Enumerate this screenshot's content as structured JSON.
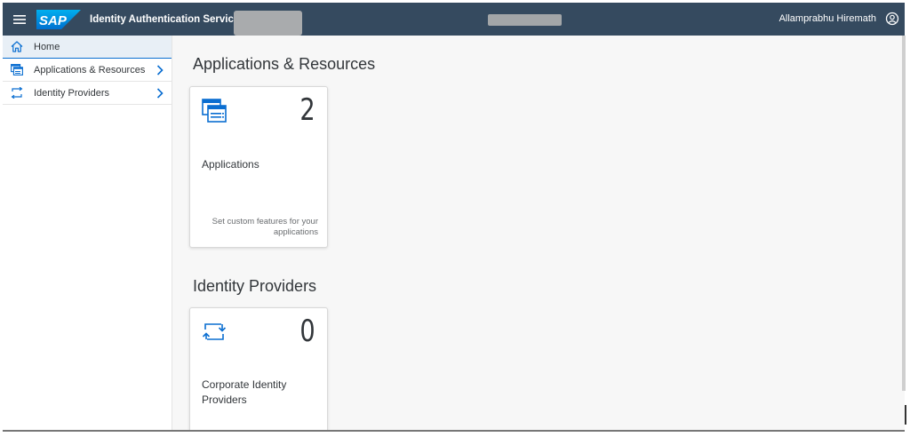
{
  "shell": {
    "product_title": "Identity Authentication Service",
    "user_name": "Allamprabhu Hiremath",
    "logo_text": "SAP",
    "menu_icon": "hamburger-icon",
    "user_icon": "user-avatar-icon"
  },
  "sidenav": {
    "items": [
      {
        "label": "Home",
        "icon": "home-icon",
        "selected": true,
        "has_chevron": false
      },
      {
        "label": "Applications & Resources",
        "icon": "applications-icon",
        "selected": false,
        "has_chevron": true
      },
      {
        "label": "Identity Providers",
        "icon": "identity-providers-icon",
        "selected": false,
        "has_chevron": true
      }
    ]
  },
  "main": {
    "sections": [
      {
        "title": "Applications & Resources",
        "tile": {
          "count": "2",
          "title": "Applications",
          "footer": "Set custom features for your applications",
          "icon": "applications-icon"
        }
      },
      {
        "title": "Identity Providers",
        "tile": {
          "count": "0",
          "title": "Corporate Identity Providers",
          "icon": "identity-providers-icon"
        }
      }
    ]
  },
  "colors": {
    "shell_bg": "#354a5f",
    "accent": "#0a6ed1",
    "icon_blue": "#0a6ed1",
    "content_bg": "#f7f7f7"
  }
}
